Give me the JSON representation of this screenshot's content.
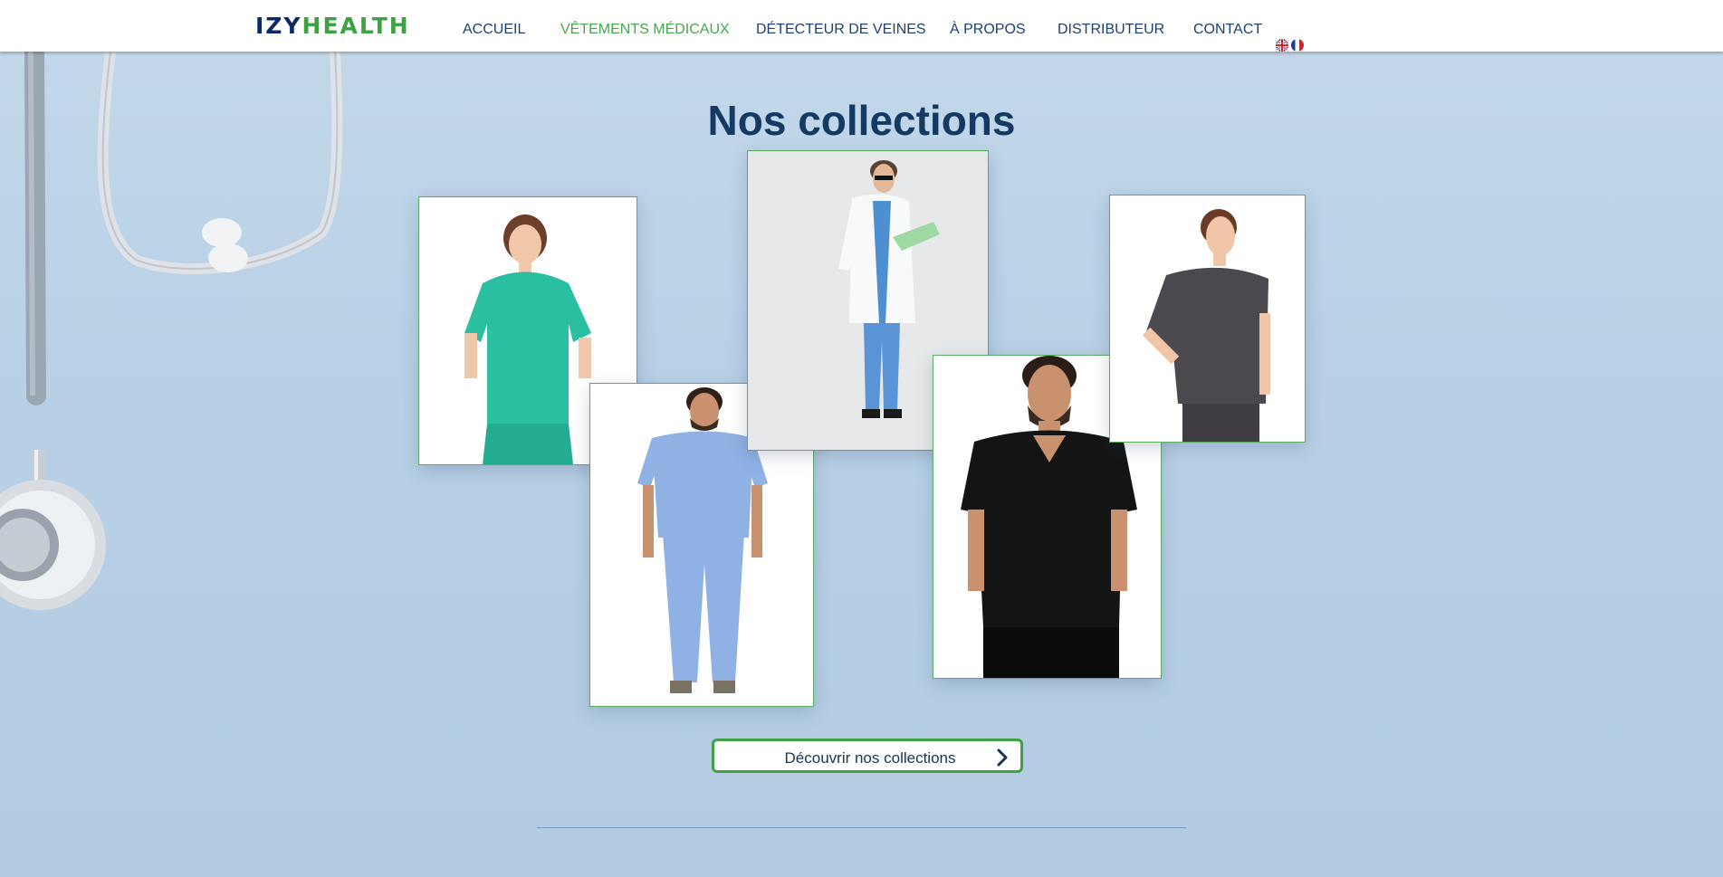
{
  "header": {
    "logo": {
      "part1": "IZY",
      "part2": "HEALTH"
    },
    "nav": [
      {
        "label": "ACCUEIL",
        "active": false
      },
      {
        "label": "VÊTEMENTS MÉDICAUX",
        "active": true
      },
      {
        "label": "DÉTECTEUR DE VEINES",
        "active": false
      },
      {
        "label": "À PROPOS",
        "active": false
      },
      {
        "label": "DISTRIBUTEUR",
        "active": false
      },
      {
        "label": "CONTACT",
        "active": false
      }
    ],
    "languages": [
      "uk-flag-icon",
      "fr-flag-icon"
    ]
  },
  "main": {
    "title": "Nos collections",
    "photos": [
      {
        "name": "woman-teal-scrubs",
        "color": "#2bbfa2"
      },
      {
        "name": "man-light-blue-scrubs",
        "color": "#8fb1e3"
      },
      {
        "name": "doctor-white-coat",
        "color": "#f4f6f8"
      },
      {
        "name": "man-black-scrubs",
        "color": "#141414"
      },
      {
        "name": "woman-grey-scrubs",
        "color": "#4b494d"
      }
    ],
    "cta": {
      "label": "Découvrir nos collections",
      "icon": "chevron-right-icon"
    }
  },
  "colors": {
    "brand_blue": "#0d2a63",
    "brand_green": "#3ea144",
    "nav_text": "#1f3f6e"
  }
}
